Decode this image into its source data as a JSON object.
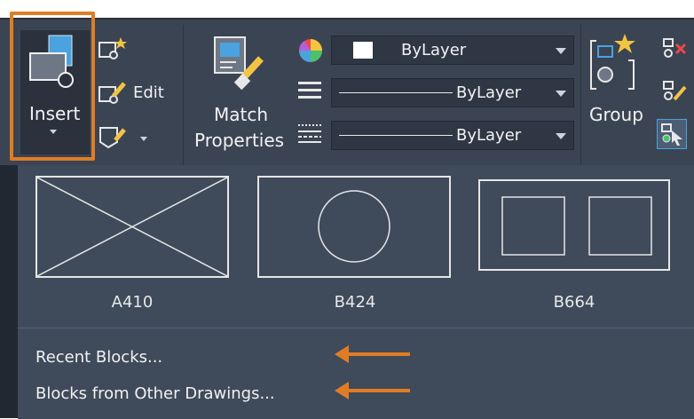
{
  "ribbon": {
    "insert_label": "Insert",
    "edit_label": "Edit",
    "match_label_line1": "Match",
    "match_label_line2": "Properties",
    "group_label": "Group",
    "color_dropdown": "ByLayer",
    "linetype_dropdown": "ByLayer",
    "lineweight_dropdown": "ByLayer"
  },
  "gallery": {
    "blocks": [
      {
        "name": "A410"
      },
      {
        "name": "B424"
      },
      {
        "name": "B664"
      }
    ]
  },
  "menu": {
    "items": [
      {
        "label": "Recent Blocks..."
      },
      {
        "label": "Blocks from Other Drawings..."
      }
    ]
  },
  "colors": {
    "ribbon_bg": "#3b4453",
    "gallery_bg": "#3f4a5b",
    "highlight": "#e07d24"
  }
}
